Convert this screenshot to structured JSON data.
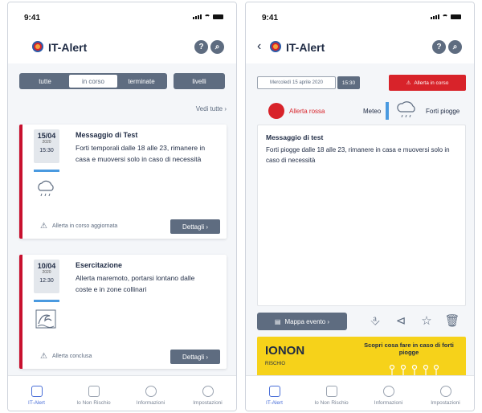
{
  "status": {
    "time": "9:41"
  },
  "app": {
    "title": "IT-Alert"
  },
  "header_buttons": {
    "help": "?",
    "search": "⌕"
  },
  "filters": {
    "tabs": [
      "tutte",
      "in corso",
      "terminate"
    ],
    "active": "in corso",
    "levels": "livelli"
  },
  "see_all": "Vedi tutte  ›",
  "alerts": [
    {
      "date": "15/04",
      "year": "2020",
      "time": "15:30",
      "title": "Messaggio di Test",
      "text": "Forti temporali dalle 18 alle 23, rimanere in casa e muoversi solo in caso di necessità",
      "icon": "rain-cloud-icon",
      "footer": "Allerta in corso aggiornata",
      "button": "Dettagli  ›"
    },
    {
      "date": "10/04",
      "year": "2020",
      "time": "12:30",
      "title": "Esercitazione",
      "text": "Allerta maremoto, portarsi lontano dalle coste e in zone collinari",
      "icon": "tsunami-wave-icon",
      "footer": "Allerta conclusa",
      "button": "Dettagli  ›"
    }
  ],
  "tabbar": [
    {
      "label": "IT-Alert",
      "icon": "alert-icon",
      "active": true
    },
    {
      "label": "Io Non Rischio",
      "icon": "hand-icon",
      "active": false
    },
    {
      "label": "Informazioni",
      "icon": "info-icon",
      "active": false
    },
    {
      "label": "Impostazioni",
      "icon": "gear-icon",
      "active": false
    }
  ],
  "detail": {
    "date": "Mercoledì 15 aprile 2020",
    "time": "15:30",
    "status": "Allerta in corso",
    "level": "Allerta rossa",
    "category": "Meteo",
    "phenomenon": "Forti piogge",
    "title": "Messaggio di test",
    "text": "Forti piogge dalle 18 alle 23, rimanere in casa e muoversi solo in caso di necessità",
    "map_button": "Mappa evento  ›",
    "banner_logo_1": "IO",
    "banner_logo_2": "NON",
    "banner_logo_3": "RISCHIO",
    "banner_text": "Scopri cosa fare in caso di forti piogge"
  },
  "colors": {
    "accent": "#5e6c80",
    "red": "#d8232a",
    "blue": "#4a9ae0",
    "yellow": "#f6d21a",
    "tab_active": "#4a6fd8"
  }
}
